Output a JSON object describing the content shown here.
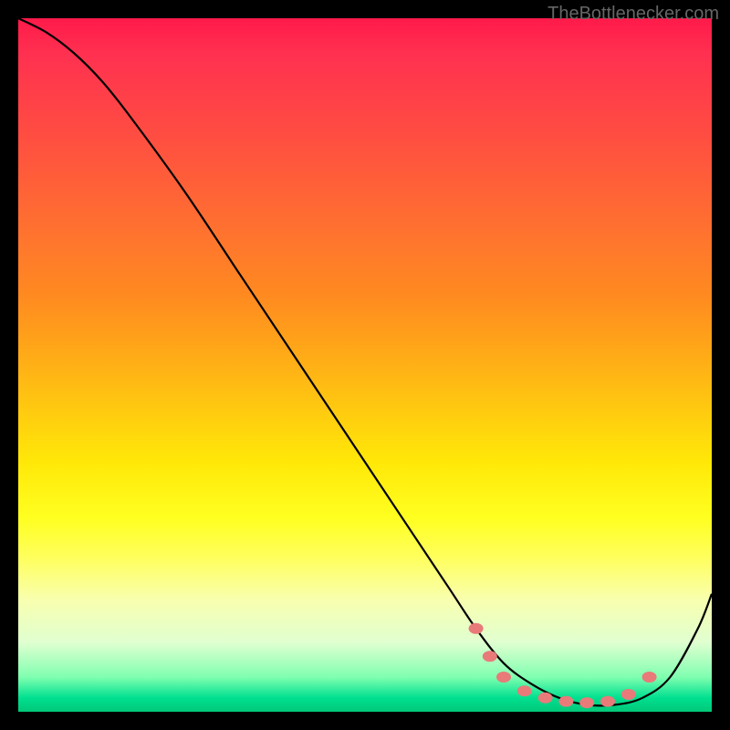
{
  "watermark": "TheBottlenecker.com",
  "chart_data": {
    "type": "line",
    "title": "",
    "xlabel": "",
    "ylabel": "",
    "xlim": [
      0,
      100
    ],
    "ylim": [
      0,
      100
    ],
    "legend": false,
    "grid": false,
    "series": [
      {
        "name": "bottleneck-curve",
        "color": "#000000",
        "x": [
          0,
          4,
          8,
          12,
          16,
          24,
          32,
          40,
          48,
          56,
          62,
          66,
          70,
          74,
          78,
          82,
          86,
          90,
          94,
          98,
          100
        ],
        "y": [
          100,
          98,
          95,
          91,
          86,
          75,
          63,
          51,
          39,
          27,
          18,
          12,
          7,
          4,
          2,
          1,
          1,
          2,
          5,
          12,
          17
        ]
      }
    ],
    "markers": {
      "name": "highlighted-range",
      "color": "#e87a7a",
      "points": [
        {
          "x": 66,
          "y": 12
        },
        {
          "x": 68,
          "y": 8
        },
        {
          "x": 70,
          "y": 5
        },
        {
          "x": 73,
          "y": 3
        },
        {
          "x": 76,
          "y": 2
        },
        {
          "x": 79,
          "y": 1.5
        },
        {
          "x": 82,
          "y": 1.3
        },
        {
          "x": 85,
          "y": 1.5
        },
        {
          "x": 88,
          "y": 2.5
        },
        {
          "x": 91,
          "y": 5
        }
      ]
    },
    "background_gradient": {
      "stops": [
        {
          "pos": 0,
          "color": "#ff1a4a"
        },
        {
          "pos": 50,
          "color": "#ffc000"
        },
        {
          "pos": 80,
          "color": "#ffff40"
        },
        {
          "pos": 100,
          "color": "#00c878"
        }
      ]
    }
  }
}
